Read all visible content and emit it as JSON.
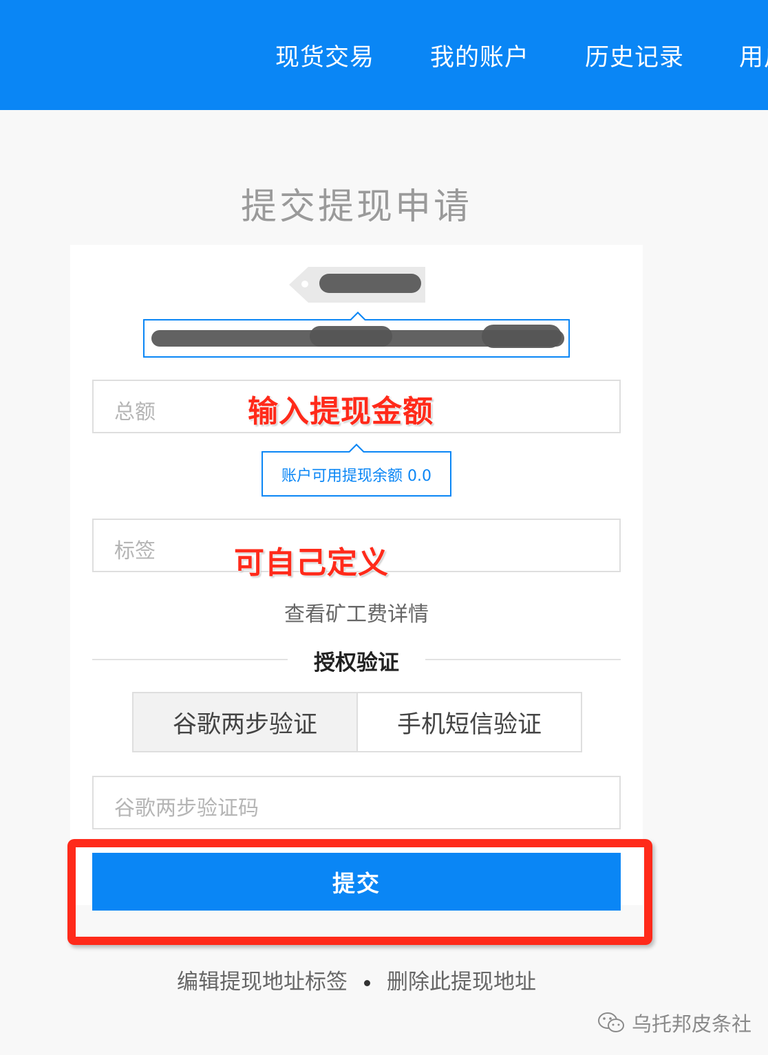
{
  "nav": {
    "items": [
      {
        "label": "现货交易"
      },
      {
        "label": "我的账户"
      },
      {
        "label": "历史记录"
      },
      {
        "label": "用户"
      }
    ]
  },
  "page": {
    "title": "提交提现申请"
  },
  "form": {
    "amount_placeholder": "总额",
    "amount_annotation": "输入提现金额",
    "available_balance_label": "账户可用提现余额",
    "available_balance_value": "0.0",
    "label_placeholder": "标签",
    "label_annotation": "可自己定义",
    "fee_details_link": "查看矿工费详情",
    "auth_section_title": "授权验证",
    "auth_tabs": [
      {
        "label": "谷歌两步验证",
        "active": true
      },
      {
        "label": "手机短信验证",
        "active": false
      }
    ],
    "code_placeholder": "谷歌两步验证码",
    "submit_label": "提交"
  },
  "footer": {
    "edit_label_link": "编辑提现地址标签",
    "delete_address_link": "删除此提现地址"
  },
  "watermark": {
    "text": "乌托邦皮条社"
  },
  "colors": {
    "accent": "#0a86f5",
    "annotation": "#ff2a1a"
  }
}
